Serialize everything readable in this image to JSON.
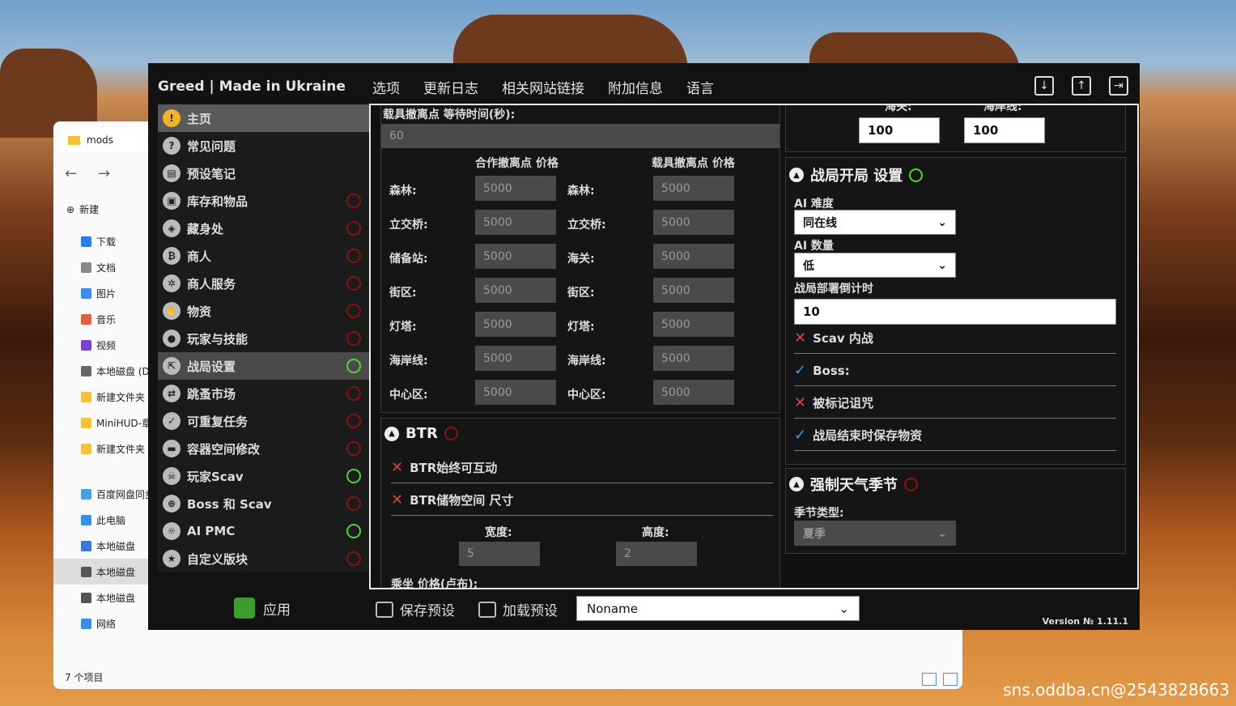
{
  "app": {
    "brand": "Greed | Made in Ukraine",
    "menu": [
      "选项",
      "更新日志",
      "相关网站链接",
      "附加信息",
      "语言"
    ]
  },
  "sidebar": [
    {
      "label": "主页",
      "icon": "warning-icon",
      "glyph": "!",
      "power": null
    },
    {
      "label": "常见问题",
      "icon": "question-icon",
      "glyph": "?",
      "power": null
    },
    {
      "label": "预设笔记",
      "icon": "book-icon",
      "glyph": "▤",
      "power": null
    },
    {
      "label": "库存和物品",
      "icon": "box-icon",
      "glyph": "▣",
      "power": "off"
    },
    {
      "label": "藏身处",
      "icon": "hideout-icon",
      "glyph": "◈",
      "power": "off"
    },
    {
      "label": "商人",
      "icon": "bitcoin-icon",
      "glyph": "₿",
      "power": "off"
    },
    {
      "label": "商人服务",
      "icon": "gear-icon",
      "glyph": "✲",
      "power": "off"
    },
    {
      "label": "物资",
      "icon": "hand-icon",
      "glyph": "✋",
      "power": "off"
    },
    {
      "label": "玩家与技能",
      "icon": "user-icon",
      "glyph": "●",
      "power": "off"
    },
    {
      "label": "战局设置",
      "icon": "exit-icon",
      "glyph": "⇱",
      "power": "on"
    },
    {
      "label": "跳蚤市场",
      "icon": "exchange-icon",
      "glyph": "⇄",
      "power": "off"
    },
    {
      "label": "可重复任务",
      "icon": "check-circle-icon",
      "glyph": "✓",
      "power": "off"
    },
    {
      "label": "容器空间修改",
      "icon": "case-icon",
      "glyph": "▬",
      "power": "off"
    },
    {
      "label": "玩家Scav",
      "icon": "scav-icon",
      "glyph": "☠",
      "power": "on"
    },
    {
      "label": "Boss 和 Scav",
      "icon": "crosshair-icon",
      "glyph": "⊕",
      "power": "off"
    },
    {
      "label": "AI PMC",
      "icon": "pmc-icon",
      "glyph": "☼",
      "power": "on"
    },
    {
      "label": "自定义版块",
      "icon": "star-icon",
      "glyph": "★",
      "power": "off"
    }
  ],
  "apply": "应用",
  "vehicle": {
    "wait_label": "载具撤离点 等待时间(秒):",
    "wait_value": "60",
    "coop_header": "合作撤离点 价格",
    "veh_header": "载具撤离点 价格",
    "coop_rows": [
      {
        "label": "森林:",
        "value": "5000"
      },
      {
        "label": "立交桥:",
        "value": "5000"
      },
      {
        "label": "储备站:",
        "value": "5000"
      },
      {
        "label": "街区:",
        "value": "5000"
      },
      {
        "label": "灯塔:",
        "value": "5000"
      },
      {
        "label": "海岸线:",
        "value": "5000"
      },
      {
        "label": "中心区:",
        "value": "5000"
      }
    ],
    "veh_rows": [
      {
        "label": "森林:",
        "value": "5000"
      },
      {
        "label": "立交桥:",
        "value": "5000"
      },
      {
        "label": "海关:",
        "value": "5000"
      },
      {
        "label": "街区:",
        "value": "5000"
      },
      {
        "label": "灯塔:",
        "value": "5000"
      },
      {
        "label": "海岸线:",
        "value": "5000"
      },
      {
        "label": "中心区:",
        "value": "5000"
      }
    ]
  },
  "btr": {
    "title": "BTR",
    "opt1": "BTR始终可互动",
    "opt2": "BTR储物空间 尺寸",
    "width_label": "宽度:",
    "height_label": "高度:",
    "width_value": "5",
    "height_value": "2",
    "cut_label": "乘坐 价格(卢布):"
  },
  "top_right": {
    "a_label": "海关:",
    "b_label": "海岸线:",
    "a_value": "100",
    "b_value": "100"
  },
  "raid": {
    "title": "战局开局 设置",
    "ai_diff_label": "AI 难度",
    "ai_diff_value": "同在线",
    "ai_count_label": "AI 数量",
    "ai_count_value": "低",
    "timer_label": "战局部署倒计时",
    "timer_value": "10",
    "checks": [
      {
        "label": "Scav 内战",
        "on": false
      },
      {
        "label": "Boss:",
        "on": true
      },
      {
        "label": "被标记诅咒",
        "on": false
      },
      {
        "label": "战局结束时保存物资",
        "on": true
      }
    ]
  },
  "weather": {
    "title": "强制天气季节",
    "season_label": "季节类型:",
    "season_value": "夏季"
  },
  "bottom": {
    "save": "保存预设",
    "load": "加载预设",
    "preset": "Noname",
    "version": "Version № 1.11.1"
  },
  "explorer": {
    "tab": "mods",
    "new": "新建",
    "items": [
      "下载",
      "文档",
      "图片",
      "音乐",
      "视频",
      "本地磁盘 (D",
      "新建文件夹",
      "MiniHUD-章",
      "新建文件夹",
      "百度网盘同步",
      "此电脑",
      "本地磁盘",
      "本地磁盘",
      "本地磁盘",
      "网络"
    ],
    "status": "7 个项目"
  },
  "watermark": "sns.oddba.cn@2543828663"
}
